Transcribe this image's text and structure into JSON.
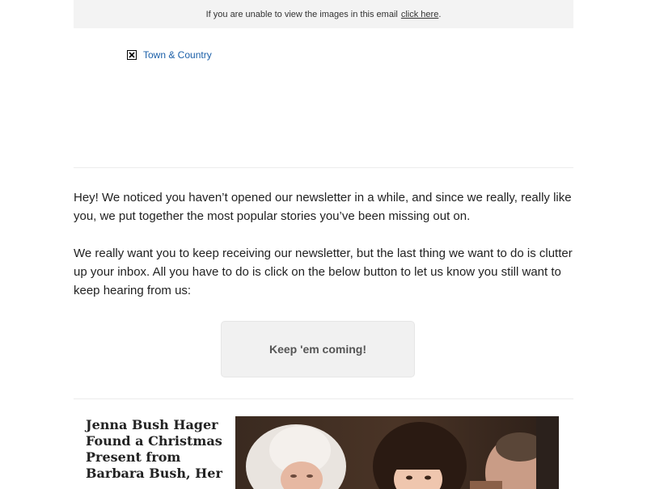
{
  "preheader": {
    "text": "If you are unable to view the images in this email",
    "link": "click here",
    "suffix": "."
  },
  "logo": {
    "icon": "broken-image-icon",
    "label": "Town & Country"
  },
  "intro": {
    "paragraph1": "Hey! We noticed you haven’t opened our newsletter in a while, and since we really, really like you, we put together the most popular stories you’ve been missing out on.",
    "paragraph2": "We really want you to keep receiving our newsletter, but the last thing we want to do is clutter up your inbox. All you have to do is click on the below button to let us know you still want to keep hearing from us:"
  },
  "cta": {
    "label": "Keep 'em coming!"
  },
  "article": {
    "title": "Jenna Bush Hager Found a Christmas Present from Barbara Bush, Her",
    "photo": "family-photo"
  },
  "colors": {
    "link": "#1a5fa8",
    "preheader_bg": "#f3f3f3",
    "button_bg": "#f1f1f1"
  }
}
